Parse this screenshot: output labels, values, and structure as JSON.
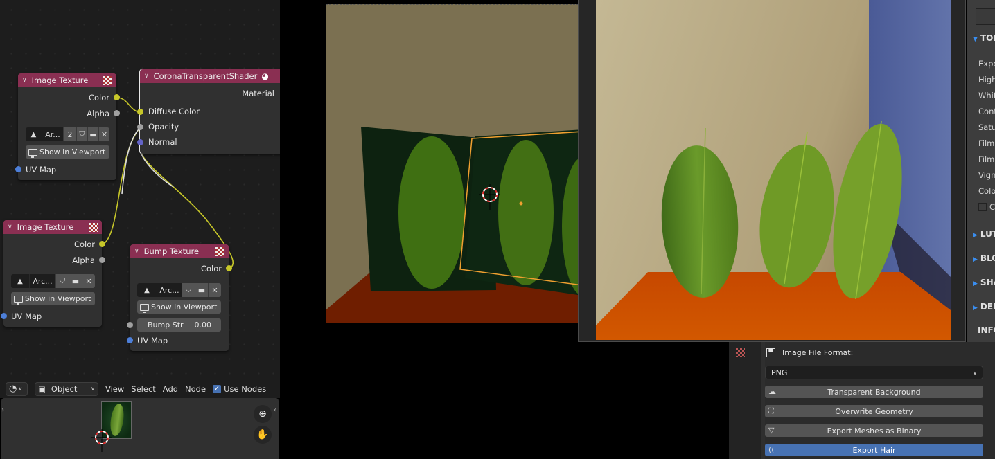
{
  "node_editor": {
    "nodes": {
      "image_texture_1": {
        "title": "Image Texture",
        "outputs": [
          "Color",
          "Alpha"
        ],
        "image_name": "Ar...",
        "users": "2",
        "show_in_viewport": "Show in Viewport",
        "inputs": [
          "UV Map"
        ]
      },
      "corona_shader": {
        "title": "CoronaTransparentShader",
        "outputs": [
          "Material"
        ],
        "inputs": [
          "Diffuse Color",
          "Opacity",
          "Normal"
        ]
      },
      "image_texture_2": {
        "title": "Image Texture",
        "outputs": [
          "Color",
          "Alpha"
        ],
        "image_name": "Arc...",
        "show_in_viewport": "Show in Viewport",
        "inputs": [
          "UV Map"
        ]
      },
      "bump_texture": {
        "title": "Bump Texture",
        "outputs": [
          "Color"
        ],
        "image_name": "Arc...",
        "show_in_viewport": "Show in Viewport",
        "bump_label": "Bump Str",
        "bump_value": "0.00",
        "inputs": [
          "UV Map"
        ]
      }
    },
    "header": {
      "mode": "Object",
      "menu": [
        "View",
        "Select",
        "Add",
        "Node"
      ],
      "use_nodes_label": "Use Nodes",
      "use_nodes_checked": true
    }
  },
  "render_settings_panel": {
    "sections": [
      {
        "label": "TON",
        "expanded": true
      },
      {
        "label": "LUT",
        "expanded": false
      },
      {
        "label": "BLO",
        "expanded": false
      },
      {
        "label": "SHA",
        "expanded": false
      },
      {
        "label": "DEN",
        "expanded": false
      }
    ],
    "tone_items": [
      "Expo",
      "High",
      "Whit",
      "Cont",
      "Satu",
      "Film",
      "Film",
      "Vign",
      "Colo"
    ],
    "checkbox_label": "C",
    "info_label": "INFO"
  },
  "export_panel": {
    "image_file_format_label": "Image File Format:",
    "image_file_format_value": "PNG",
    "buttons": [
      "Transparent Background",
      "Overwrite Geometry",
      "Export Meshes as Binary",
      "Export Hair"
    ],
    "active_button": "Export Hair"
  },
  "colors": {
    "node_header": "#8a2f52",
    "accent_blue": "#4772b3",
    "selection_orange": "#f0a030"
  }
}
